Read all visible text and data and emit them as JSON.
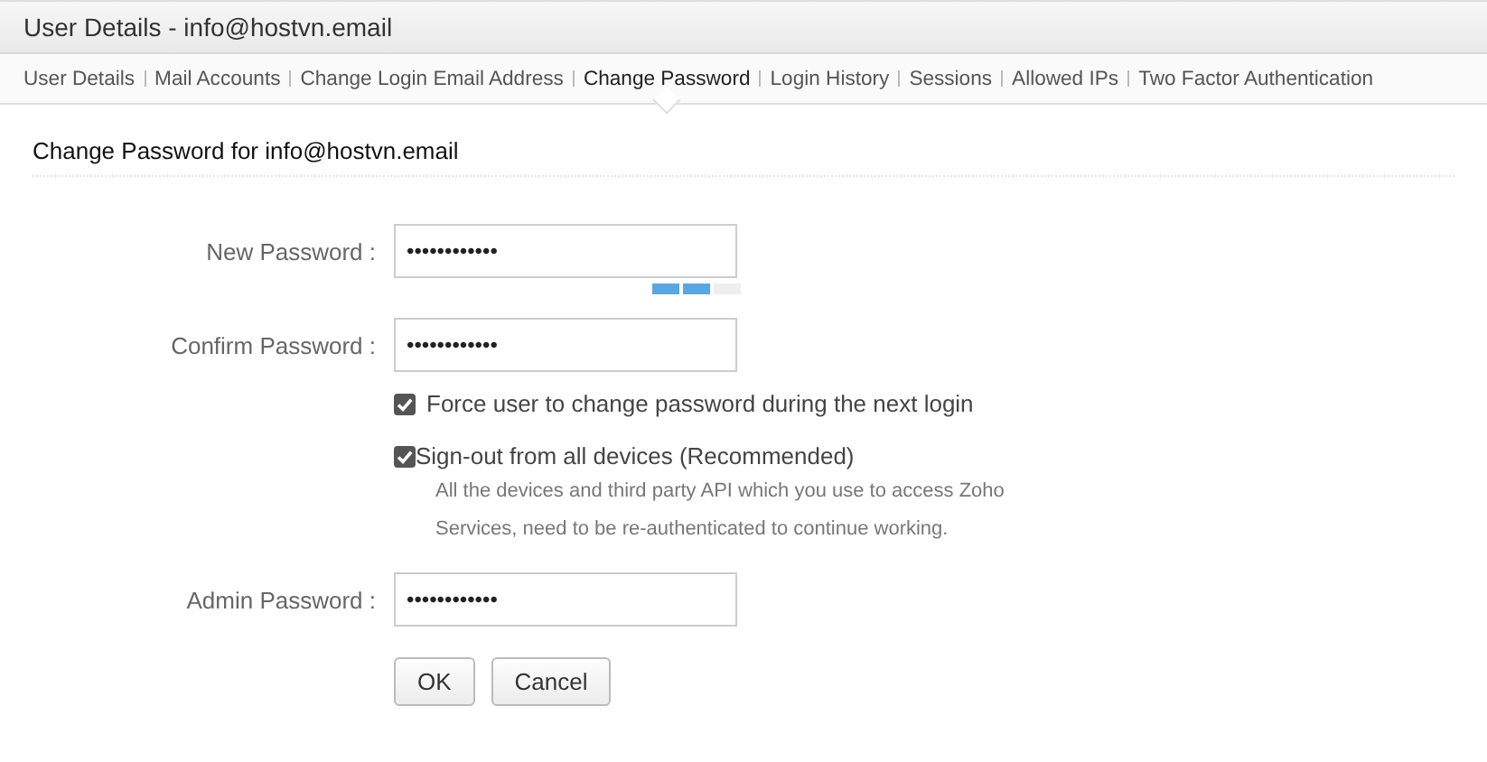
{
  "window": {
    "title": "User Details - info@hostvn.email"
  },
  "tabs": [
    {
      "label": "User Details",
      "selected": false
    },
    {
      "label": "Mail Accounts",
      "selected": false
    },
    {
      "label": "Change Login Email Address",
      "selected": false
    },
    {
      "label": "Change Password",
      "selected": true
    },
    {
      "label": "Login History",
      "selected": false
    },
    {
      "label": "Sessions",
      "selected": false
    },
    {
      "label": "Allowed IPs",
      "selected": false
    },
    {
      "label": "Two Factor Authentication",
      "selected": false
    }
  ],
  "heading": "Change Password for info@hostvn.email",
  "new_password": {
    "label": "New Password :",
    "value": "••••••••••••",
    "strength": {
      "level": 0.67
    }
  },
  "confirm_password": {
    "label": "Confirm Password :",
    "value": "••••••••••••"
  },
  "options": [
    {
      "label": "Force user to change password during the next login",
      "checked": true
    },
    {
      "label": "Sign-out from all devices (Recommended)",
      "checked": true,
      "description": [
        "All the devices and third party API which you use to access Zoho",
        "Services, need to be re-authenticated to continue working."
      ]
    }
  ],
  "admin_password": {
    "label": "Admin Password :",
    "value": "••••••••••••"
  },
  "buttons": [
    "OK",
    "Cancel"
  ]
}
